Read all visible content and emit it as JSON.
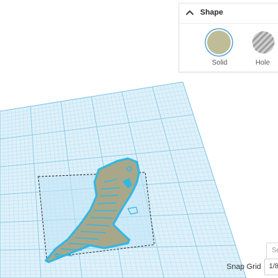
{
  "shape_panel": {
    "title": "Shape",
    "options": [
      {
        "label": "Solid",
        "color": "#bfbd98",
        "selected": true
      },
      {
        "label": "Hole",
        "color": "#a9a9a9",
        "selected": false
      }
    ]
  },
  "bottom_bar": {
    "search_text": "Se",
    "snap_grid_label": "Snap Grid",
    "snap_grid_value": "1/8"
  },
  "colors": {
    "grid_fill": "#def1fa",
    "grid_line": "#a9d6ec",
    "object_fill": "#a9a789",
    "object_outline": "#33b7e2",
    "selection_box": "#2a2a2a"
  }
}
